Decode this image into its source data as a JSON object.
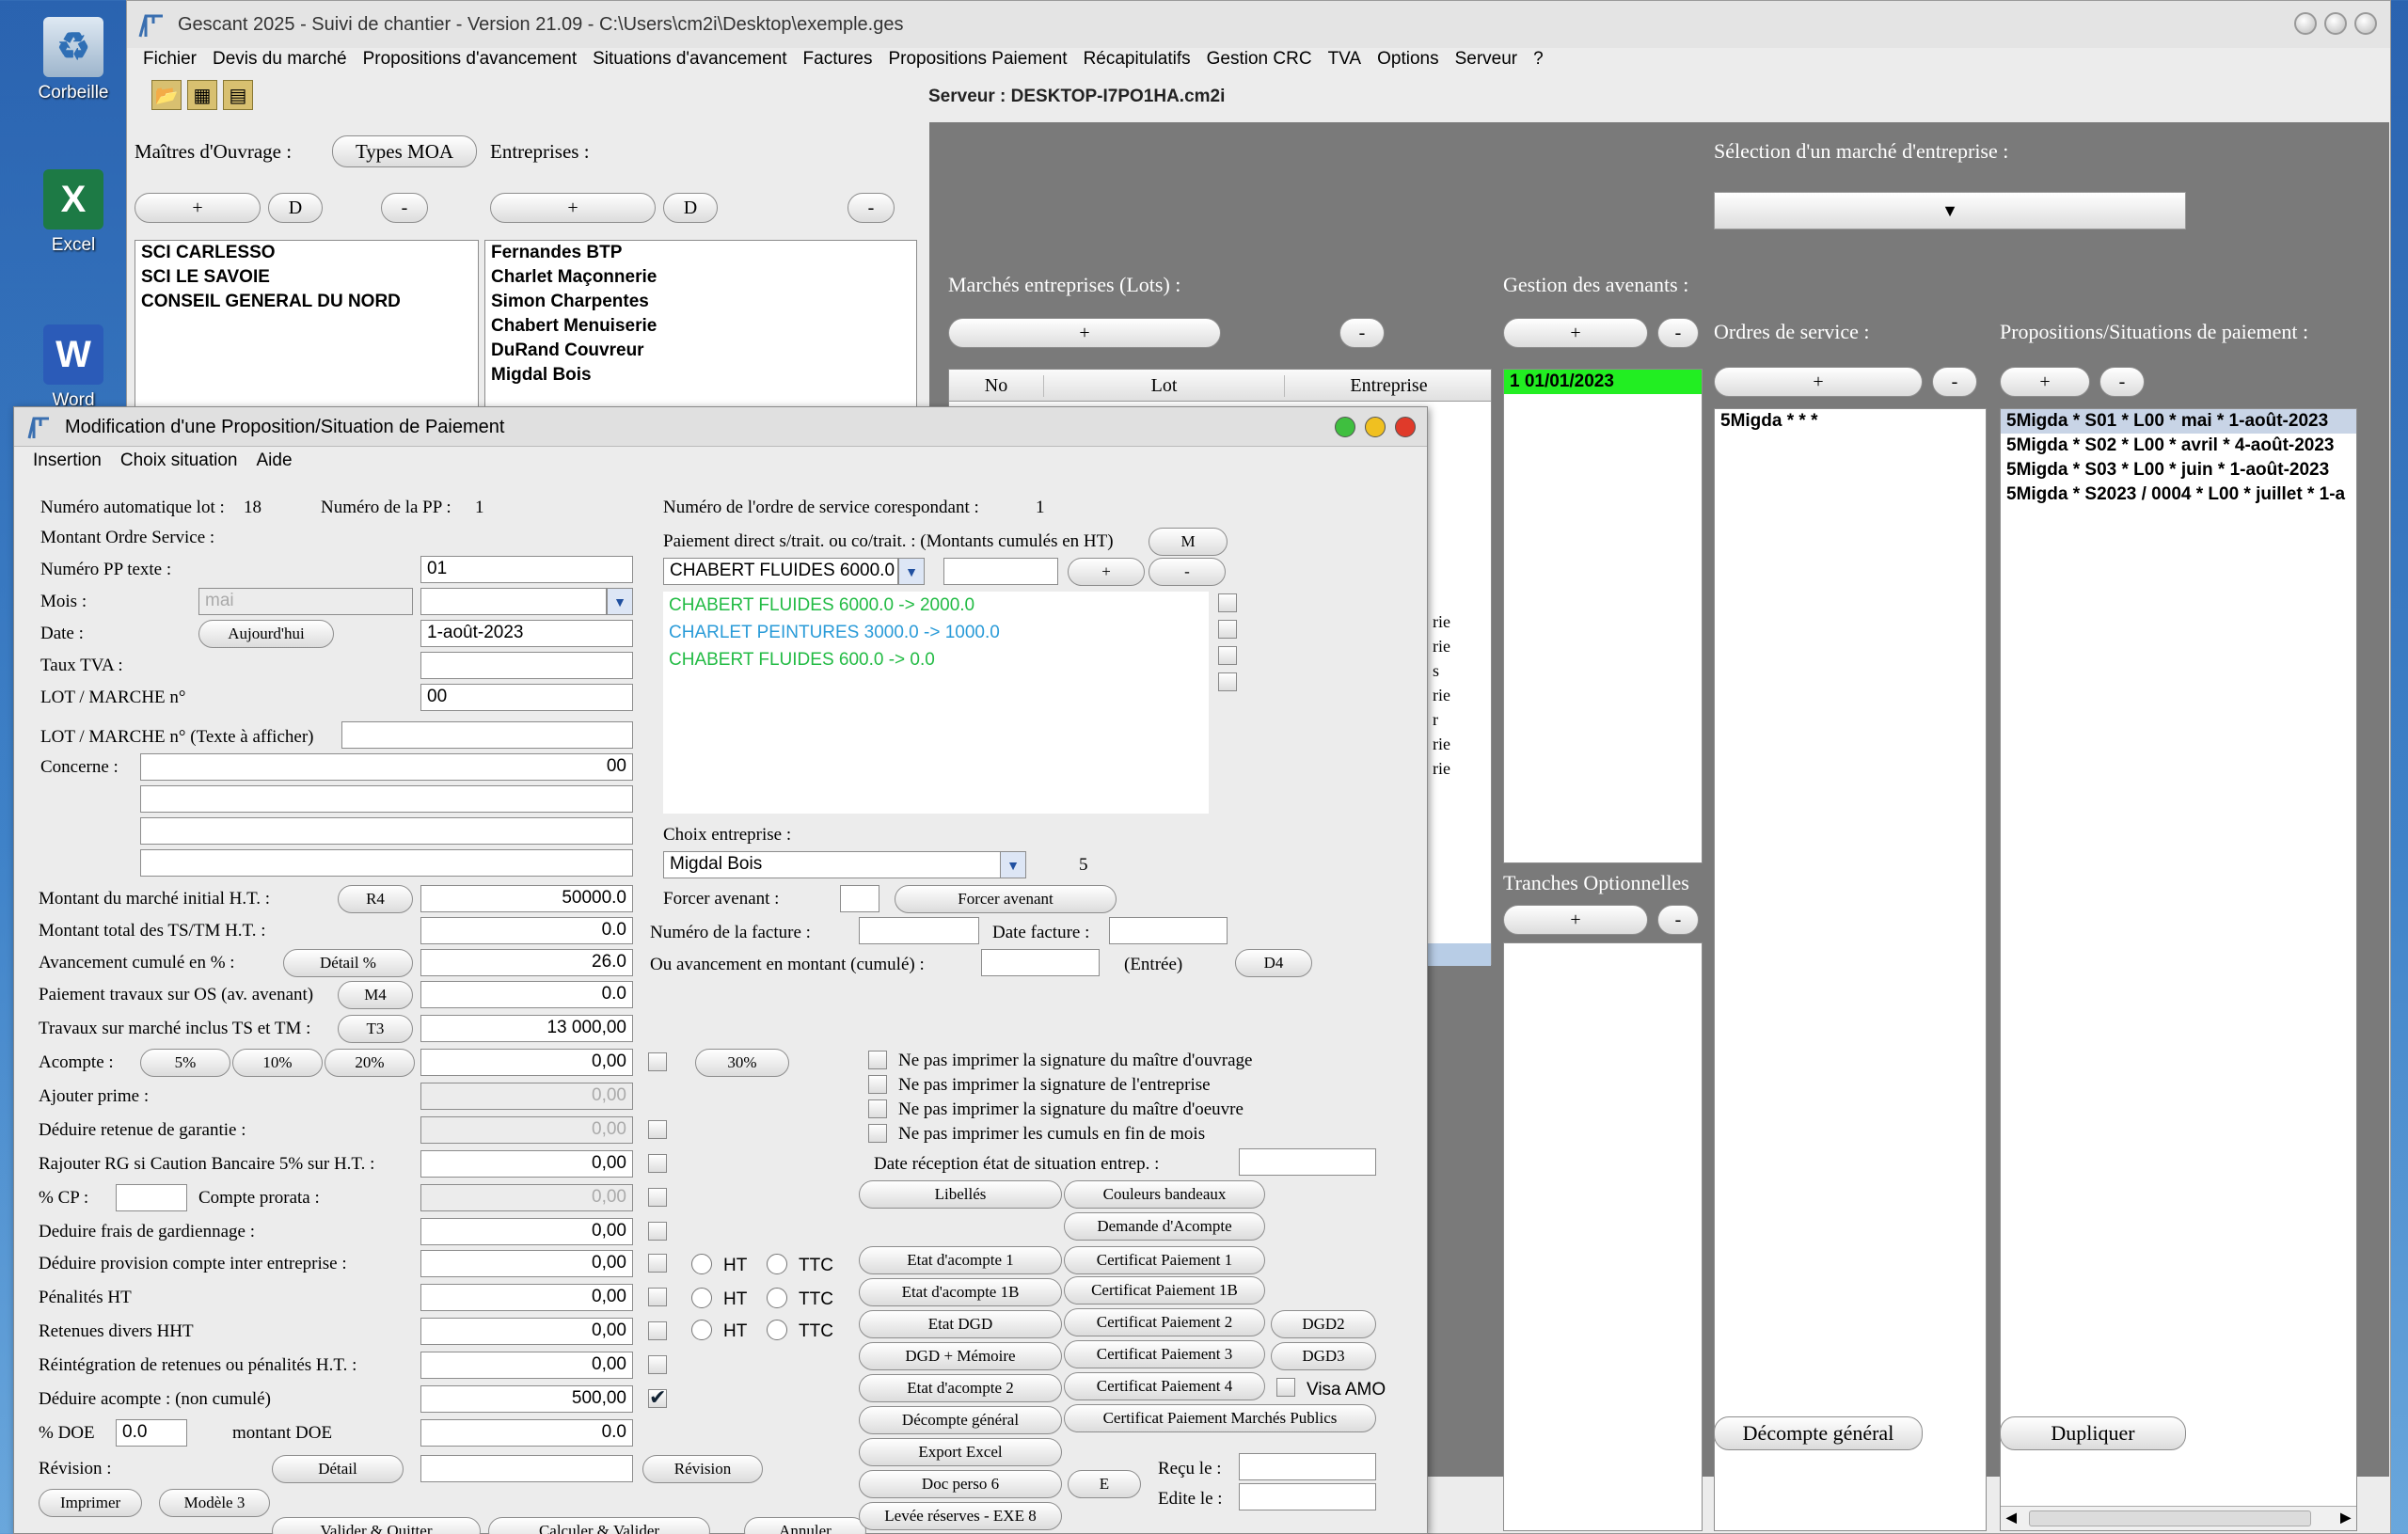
{
  "desktop": {
    "icons": [
      {
        "label": "Corbeille"
      },
      {
        "label": "Excel"
      },
      {
        "label": "Word"
      }
    ]
  },
  "main_window": {
    "title": "Gescant 2025 - Suivi de chantier - Version 21.09 - C:\\Users\\cm2i\\Desktop\\exemple.ges",
    "menu": [
      "Fichier",
      "Devis du marché",
      "Propositions d'avancement",
      "Situations d'avancement",
      "Factures",
      "Propositions Paiement",
      "Récapitulatifs",
      "Gestion CRC",
      "TVA",
      "Options",
      "Serveur",
      "?"
    ],
    "server_label": "Serveur : DESKTOP-I7PO1HA.cm2i",
    "moa_label": "Maîtres d'Ouvrage :",
    "types_moa": "Types MOA",
    "entreprises_label": "Entreprises :",
    "plus": "+",
    "minus": "-",
    "d": "D",
    "moa_list": [
      "SCI CARLESSO",
      "SCI LE SAVOIE",
      "CONSEIL GENERAL DU NORD"
    ],
    "entreprises_list": [
      "Fernandes BTP",
      "Charlet Maçonnerie",
      "Simon Charpentes",
      "Chabert Menuiserie",
      "DuRand Couvreur",
      "Migdal Bois"
    ],
    "selection_label": "Sélection d'un marché d'entreprise :",
    "marches_label": "Marchés entreprises (Lots) :",
    "avenants_label": "Gestion des avenants :",
    "os_label": "Ordres de service :",
    "pp_label": "Propositions/Situations de paiement :",
    "table_headers": [
      "No",
      "Lot",
      "Entreprise"
    ],
    "entreprise_partial": [
      "rie",
      "rie",
      "s",
      "rie",
      "r",
      "rie",
      "rie"
    ],
    "avenant_item": "1 01/01/2023",
    "os_item": "5Migda *  *  *",
    "pp_items": [
      "5Migda * S01 * L00 * mai * 1-août-2023",
      "5Migda * S02 * L00 * avril * 4-août-2023",
      "5Migda * S03 * L00 * juin * 1-août-2023",
      "5Migda * S2023 / 0004 * L00 * juillet * 1-a"
    ],
    "tranches_label": "Tranches Optionnelles",
    "decompte_general": "Décompte général",
    "dupliquer": "Dupliquer"
  },
  "dialog": {
    "title": "Modification d'une Proposition/Situation de Paiement",
    "menu": [
      "Insertion",
      "Choix situation",
      "Aide"
    ],
    "num_auto_label": "Numéro automatique lot :",
    "num_auto_val": "18",
    "num_pp_label": "Numéro de la PP :",
    "num_pp_val": "1",
    "num_os_label": "Numéro de l'ordre de service corespondant :",
    "num_os_val": "1",
    "montant_os_label": "Montant Ordre Service :",
    "num_pp_texte_label": "Numéro PP texte :",
    "num_pp_texte_val": "01",
    "mois_label": "Mois  :",
    "mois_placeholder": "mai",
    "date_label": "Date :",
    "aujourdhui": "Aujourd'hui",
    "date_val": "1-août-2023",
    "taux_tva_label": "Taux TVA :",
    "lot_label": "LOT / MARCHE n°",
    "lot_val": "00",
    "lot_texte_label": "LOT / MARCHE n° (Texte à afficher)",
    "concerne_label": "Concerne :",
    "concerne_val": "00",
    "paiement_direct_label": "Paiement direct s/trait. ou co/trait. : (Montants cumulés en HT)",
    "m_btn": "M",
    "combo_val": "CHABERT FLUIDES 6000.0",
    "pd_items": [
      {
        "text": "CHABERT FLUIDES 6000.0 -> 2000.0",
        "color": "#22bb44"
      },
      {
        "text": "CHARLET PEINTURES 3000.0 -> 1000.0",
        "color": "#2a9bd8"
      },
      {
        "text": "CHABERT FLUIDES 600.0 -> 0.0",
        "color": "#22bb44"
      }
    ],
    "choix_entreprise_label": "Choix entreprise :",
    "choix_entreprise_val": "Migdal Bois",
    "choix_entreprise_num": "5",
    "forcer_avenant_label": "Forcer avenant :",
    "forcer_avenant_btn": "Forcer avenant",
    "num_facture_label": "Numéro de la facture :",
    "date_facture_label": "Date facture :",
    "avancement_montant_label": "Ou avancement en montant (cumulé) :",
    "entree": "(Entrée)",
    "d4": "D4",
    "rows": [
      {
        "label": "Montant du marché initial H.T. :",
        "btn": "R4",
        "val": "50000.0"
      },
      {
        "label": "Montant total des TS/TM H.T. :",
        "btn": "",
        "val": "0.0"
      },
      {
        "label": "Avancement cumulé en % :",
        "btn": "Détail %",
        "val": "26.0"
      },
      {
        "label": "Paiement travaux sur OS (av. avenant)",
        "btn": "M4",
        "val": "0.0"
      },
      {
        "label": "Travaux sur marché inclus TS et TM :",
        "btn": "T3",
        "val": "13 000,00"
      }
    ],
    "acompte_label": "Acompte :",
    "pct5": "5%",
    "pct10": "10%",
    "pct20": "20%",
    "pct30": "30%",
    "acompte_val": "0,00",
    "ajouter_prime_label": "Ajouter prime :",
    "ajouter_prime_val": "0,00",
    "deduire_rg_label": "Déduire retenue de garantie :",
    "deduire_rg_val": "0,00",
    "rajouter_rg_label": "Rajouter RG si Caution Bancaire 5% sur H.T. :",
    "rajouter_rg_val": "0,00",
    "cp_label": "% CP :",
    "compte_prorata_label": "Compte prorata :",
    "compte_prorata_val": "0,00",
    "frais_gard_label": "Deduire frais de gardiennage :",
    "frais_gard_val": "0,00",
    "provision_label": "Déduire provision compte inter entreprise :",
    "provision_val": "0,00",
    "penalites_label": "Pénalités HT",
    "penalites_val": "0,00",
    "retenues_label": "Retenues divers HHT",
    "retenues_val": "0,00",
    "reintegration_label": "Réintégration de retenues ou pénalités H.T. :",
    "reintegration_val": "0,00",
    "deduire_acompte_label": "Déduire acompte : (non cumulé)",
    "deduire_acompte_val": "500,00",
    "doe_label": "% DOE",
    "doe_val": "0.0",
    "montant_doe_label": "montant DOE",
    "montant_doe_val": "0.0",
    "revision_label": "Révision :",
    "detail": "Détail",
    "revision_btn": "Révision",
    "imprimer": "Imprimer",
    "modele3": "Modèle 3",
    "ht": "HT",
    "ttc": "TTC",
    "checks": [
      "Ne pas imprimer la signature du maître d'ouvrage",
      "Ne pas imprimer la signature de l'entreprise",
      "Ne pas imprimer la signature du maître d'oeuvre",
      "Ne pas imprimer les cumuls en fin de mois"
    ],
    "date_reception_label": "Date réception état de situation entrep. :",
    "btn_libelles": "Libellés",
    "btn_couleurs": "Couleurs bandeaux",
    "btn_demande": "Demande d'Acompte",
    "btn_etat1": "Etat d'acompte 1",
    "btn_cert1": "Certificat Paiement 1",
    "btn_etat1b": "Etat d'acompte 1B",
    "btn_cert1b": "Certificat Paiement 1B",
    "btn_dgd": "Etat DGD",
    "btn_cert2": "Certificat Paiement 2",
    "btn_dgd2": "DGD2",
    "btn_dgd_memoire": "DGD + Mémoire",
    "btn_cert3": "Certificat Paiement 3",
    "btn_dgd3": "DGD3",
    "btn_etat2": "Etat d'acompte 2",
    "btn_cert4": "Certificat Paiement 4",
    "visa_amo": "Visa AMO",
    "btn_decompte": "Décompte général",
    "btn_cert_mp": "Certificat Paiement Marchés Publics",
    "btn_export": "Export Excel",
    "recu_label": "Reçu le :",
    "btn_doc6": "Doc perso 6",
    "btn_e": "E",
    "edite_label": "Edite le :",
    "btn_levee": "Levée réserves - EXE 8",
    "btn_valider_quitter": "Valider & Quitter",
    "btn_calculer": "Calculer & Valider",
    "btn_annuler": "Annuler"
  }
}
